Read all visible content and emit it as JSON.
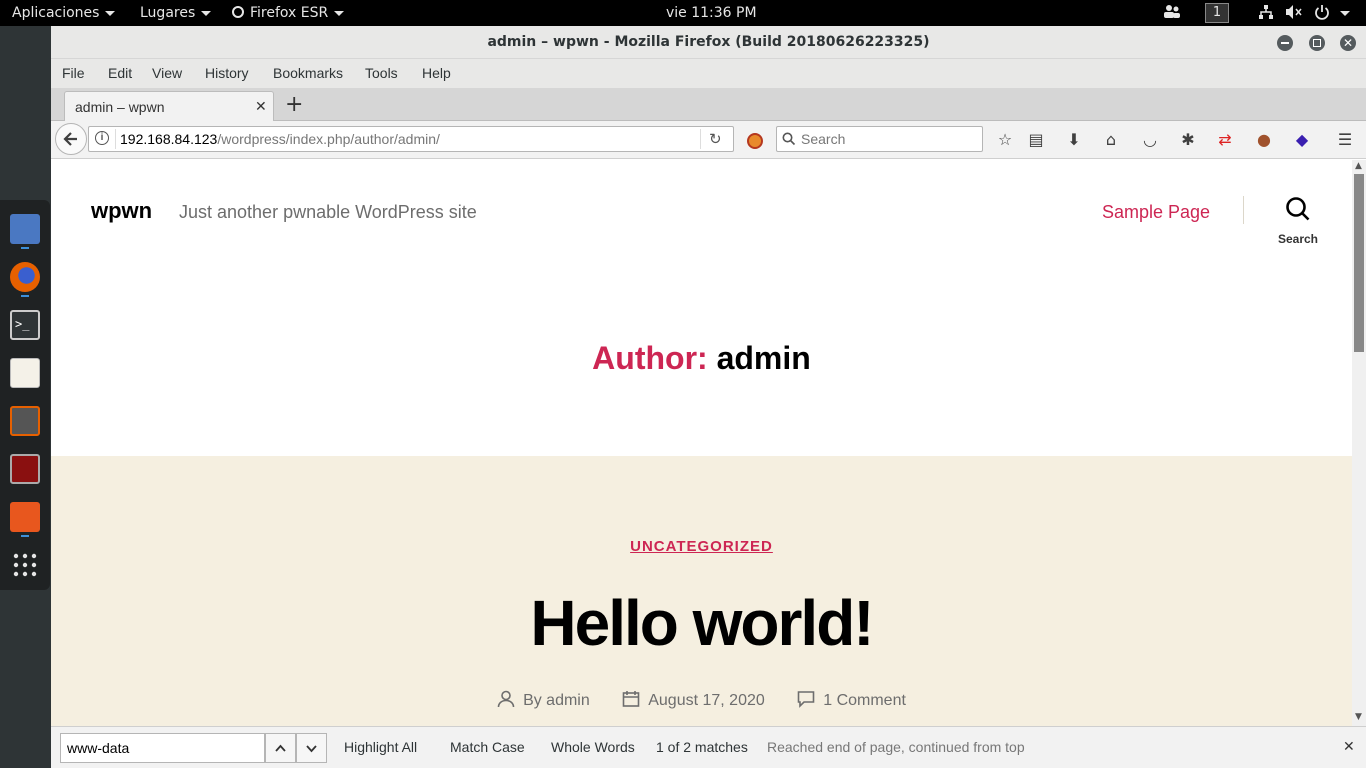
{
  "topbar": {
    "applications": "Aplicaciones",
    "places": "Lugares",
    "app_menu": "Firefox ESR",
    "clock": "vie 11:36 PM",
    "workspace": "1"
  },
  "window": {
    "title": "admin – wpwn - Mozilla Firefox (Build 20180626223325)"
  },
  "menubar": {
    "file": "File",
    "edit": "Edit",
    "view": "View",
    "history": "History",
    "bookmarks": "Bookmarks",
    "tools": "Tools",
    "help": "Help"
  },
  "tabs": [
    {
      "label": "admin – wpwn"
    }
  ],
  "navbar": {
    "url_host": "192.168.84.123",
    "url_path": "/wordpress/index.php/author/admin/",
    "search_placeholder": "Search"
  },
  "site": {
    "title": "wpwn",
    "description": "Just another pwnable WordPress site",
    "nav_sample_page": "Sample Page",
    "search_label": "Search",
    "archive_prefix": "Author:",
    "archive_name": "admin",
    "accent_color": "#cd2653",
    "post_bg_color": "#f5efe0"
  },
  "post": {
    "category": "UNCATEGORIZED",
    "title": "Hello world!",
    "author": "By admin",
    "date": "August 17, 2020",
    "comments": "1 Comment"
  },
  "findbar": {
    "query": "www-data",
    "highlight_all": "Highlight All",
    "match_case": "Match Case",
    "whole_words": "Whole Words",
    "match_count": "1 of 2 matches",
    "status": "Reached end of page, continued from top"
  }
}
